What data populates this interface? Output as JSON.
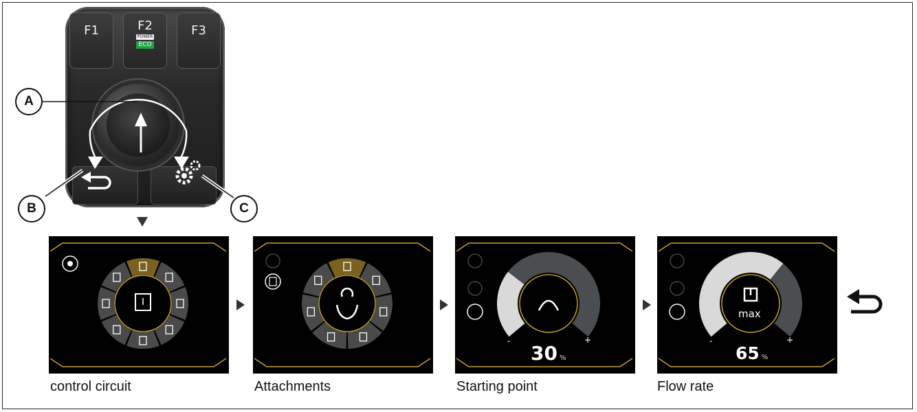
{
  "callouts": {
    "a": "A",
    "b": "B",
    "c": "C"
  },
  "controller": {
    "f1_label": "F1",
    "f2_label": "F2",
    "f2_power": "POWER",
    "f2_eco": "ECO",
    "f3_label": "F3"
  },
  "screens": [
    {
      "caption": "control circuit"
    },
    {
      "caption": "Attachments"
    },
    {
      "caption": "Starting point",
      "percent": "30",
      "unit": "%",
      "minus": "-",
      "plus": "+",
      "gauge_level": 0.3
    },
    {
      "caption": "Flow rate",
      "percent": "65",
      "unit": "%",
      "minus": "-",
      "plus": "+",
      "center_label": "max",
      "gauge_level": 0.65
    }
  ],
  "colors": {
    "accent": "#c9a227",
    "selected_segment": "#7a6120",
    "segment": "#4a4a4a",
    "gauge_light": "#d9d9d9",
    "gauge_dark": "#4b4e50",
    "eco_green": "#25a04a"
  },
  "icons": {
    "return": "return-arrow-icon",
    "settings": "gears-icon",
    "knob": "up-arrow-icon"
  }
}
